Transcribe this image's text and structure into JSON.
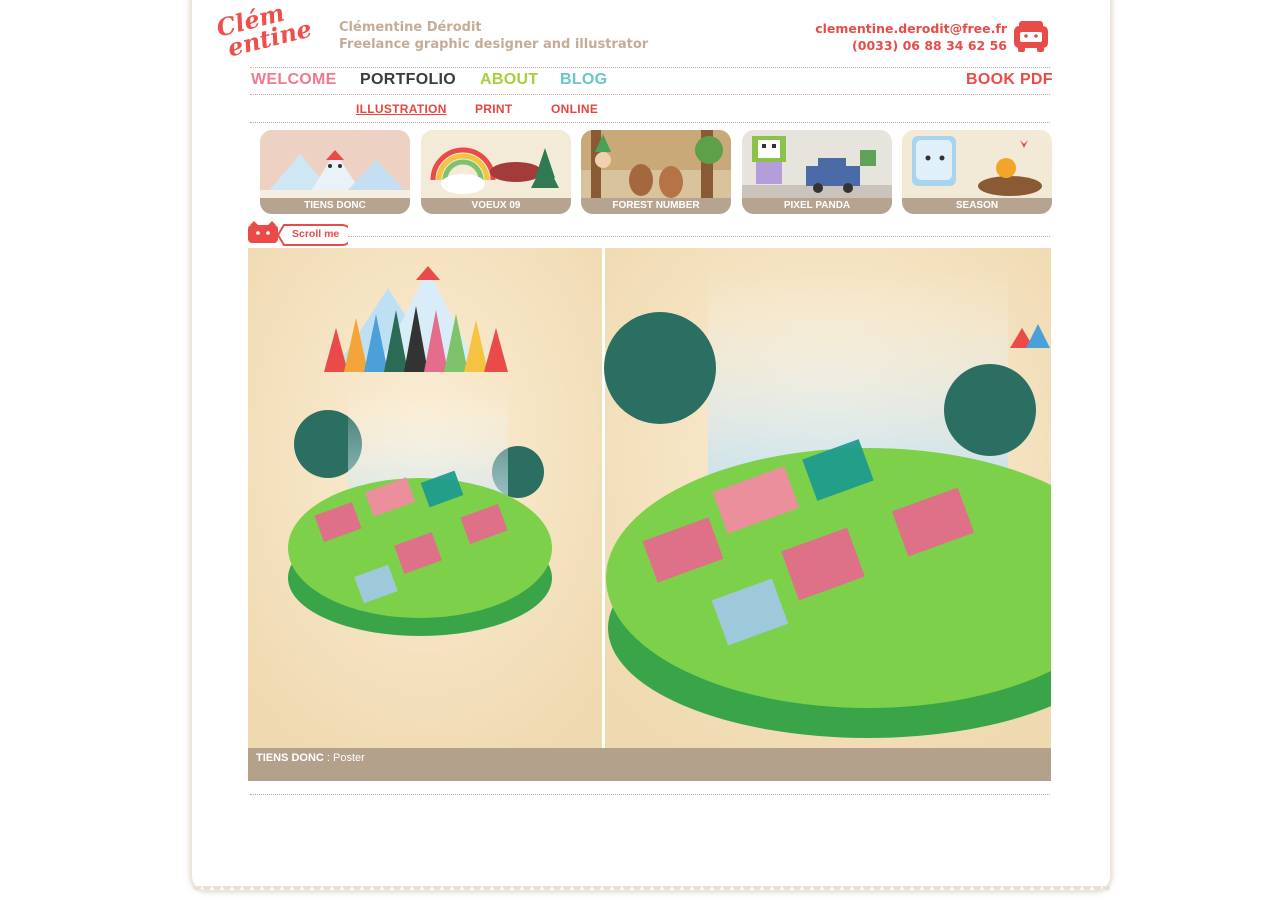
{
  "header": {
    "logo_line1": "Clém",
    "logo_line2": "entine",
    "name": "Clémentine Dérodit",
    "tagline": "Freelance graphic designer and illustrator",
    "email": "clementine.derodit@free.fr",
    "phone": "(0033) 06 88 34 62 56"
  },
  "nav": {
    "welcome": "WELCOME",
    "portfolio": "PORTFOLIO",
    "about": "ABOUT",
    "blog": "BLOG",
    "book_pdf": "BOOK PDF"
  },
  "subnav": {
    "illustration": "ILLUSTRATION",
    "print": "PRINT",
    "online": "ONLINE"
  },
  "thumbs": [
    "TIENS DONC",
    "VOEUX 09",
    "FOREST NUMBER",
    "PIXEL PANDA",
    "SEASON"
  ],
  "scroll_label": "Scroll me",
  "caption": {
    "title": "TIENS DONC",
    "separator": " : ",
    "type": "Poster"
  },
  "colors": {
    "accent": "#e94c48",
    "welcome": "#ef7a8f",
    "portfolio": "#3b3b3b",
    "about": "#a6cf3a",
    "blog": "#67c6c8",
    "caption_bar": "#b4a18c"
  }
}
